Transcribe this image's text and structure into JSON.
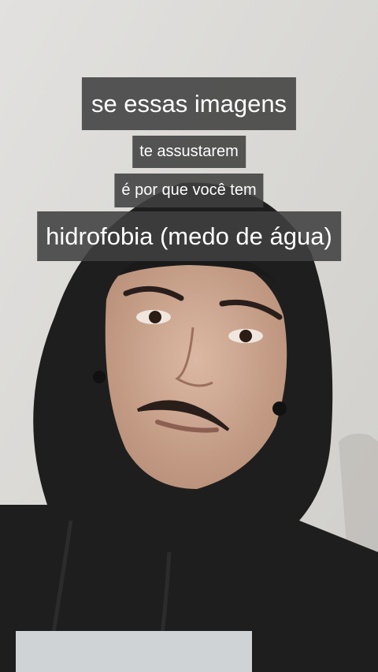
{
  "captions": [
    "se essas imagens",
    "te assustarem",
    "é por que você tem",
    "hidrofobia (medo de água)"
  ],
  "colors": {
    "wall": "#dcdbd9",
    "hoodie": "#1f1f1f",
    "skin": "#cfa892",
    "caption_bg": "#404040",
    "caption_text": "#ffffff"
  }
}
